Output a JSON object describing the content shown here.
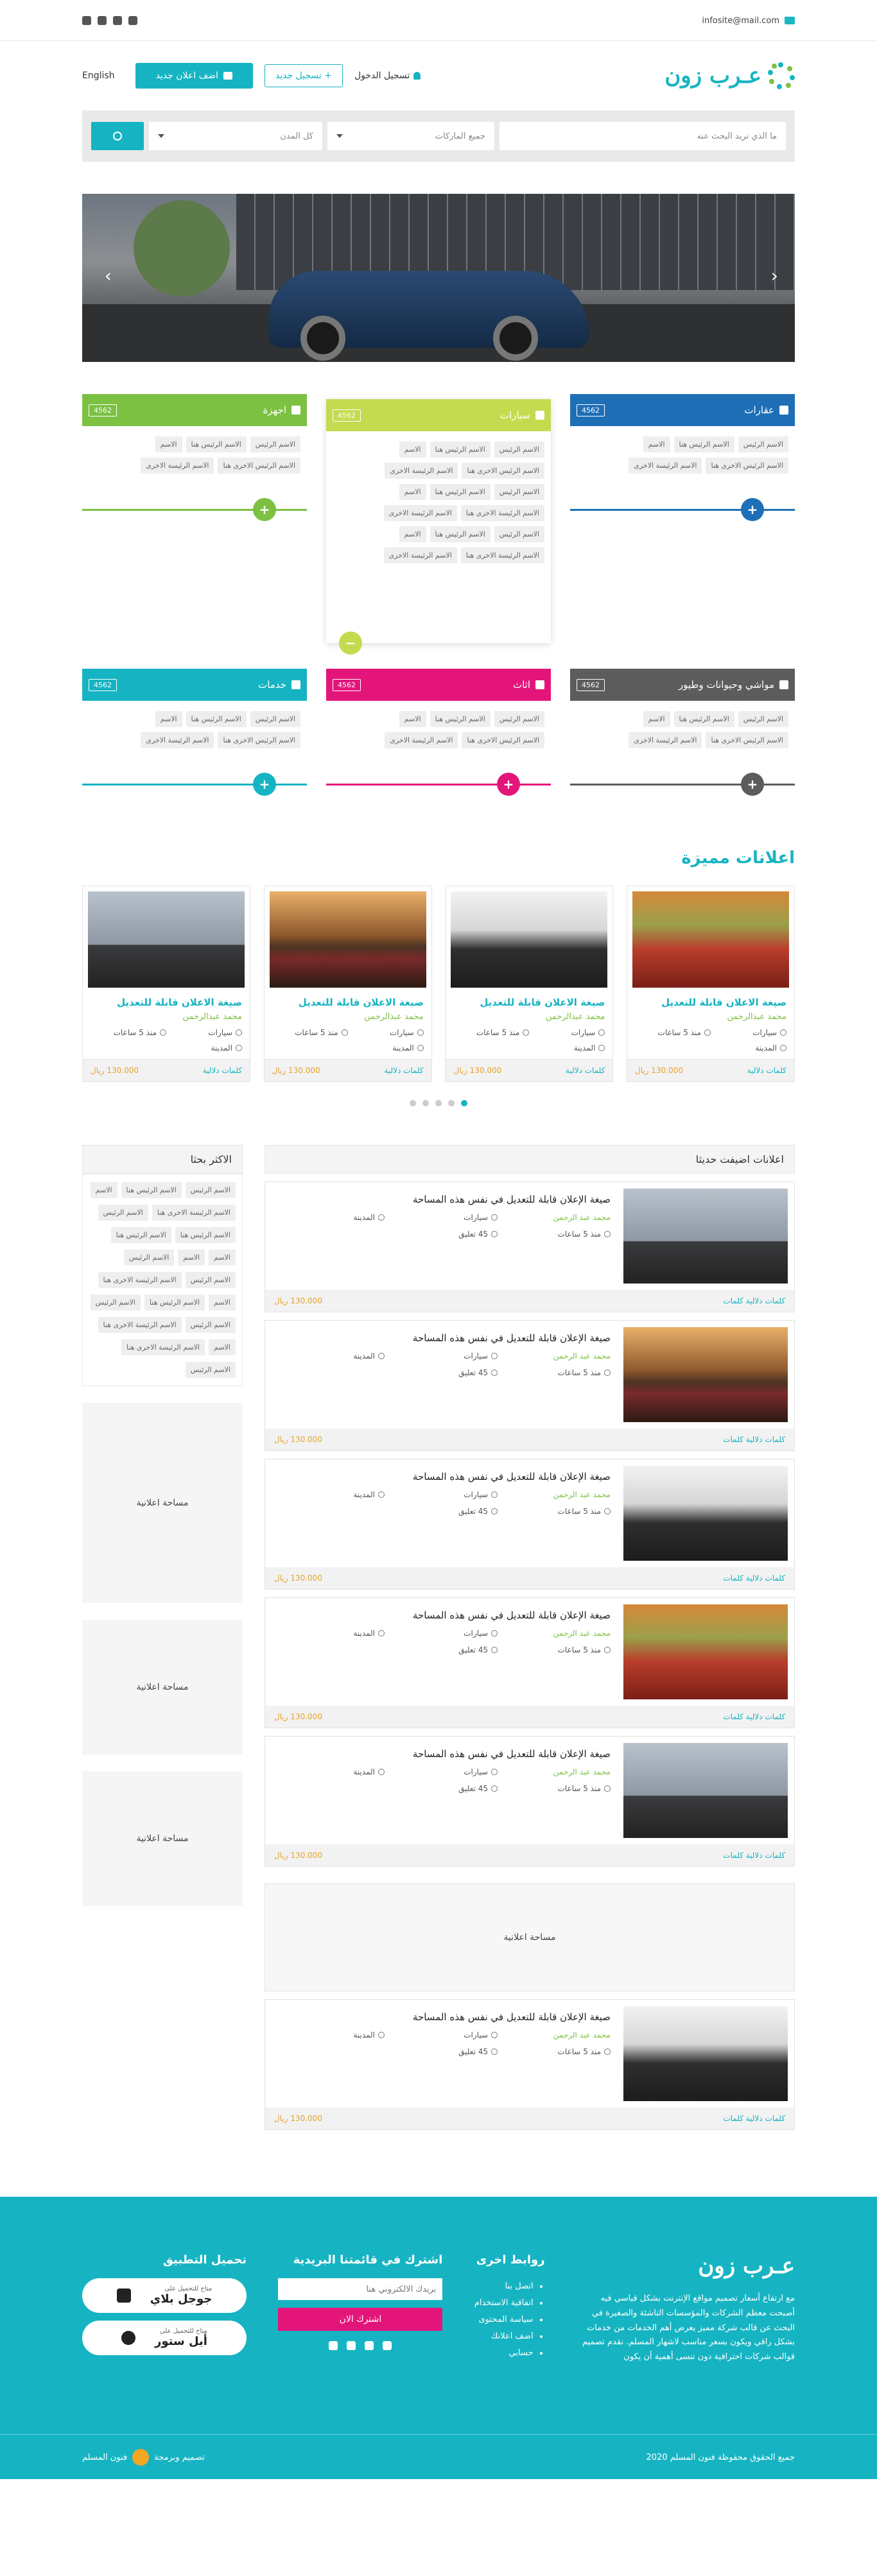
{
  "topbar": {
    "email": "infosite@mail.com",
    "social_icons": [
      "instagram-icon",
      "snapchat-icon",
      "twitter-icon",
      "email-icon"
    ]
  },
  "header": {
    "logo_text": "عـرب زون",
    "login": "تسجيل الدخول",
    "register": "تسجيل جديد",
    "add_ad": "اضف اعلان جديد",
    "language": "English"
  },
  "search": {
    "placeholder": "ما الذي تريد البحث عنه",
    "brands": "جميع الماركات",
    "cities": "كل المدن"
  },
  "categories": [
    {
      "title": "عقارات",
      "count": "4562",
      "color": "#1f6fb7",
      "tags": [
        "الاسم الرئيس",
        "الاسم الرئيس هنا",
        "الاسم",
        "الاسم الرئيس الاخرى هنا",
        "الاسم الرئيسة الاخرى"
      ]
    },
    {
      "title": "سيارات",
      "count": "4562",
      "color": "#c4db4f",
      "tags": [
        "الاسم الرئيس",
        "الاسم الرئيس هنا",
        "الاسم",
        "الاسم الرئيس الاخرى هنا",
        "الاسم الرئيسة الاخرى",
        "الاسم الرئيس",
        "الاسم الرئيس هنا",
        "الاسم",
        "الاسم الرئيسة الاخرى هنا",
        "الاسم الرئيسة الاخرى",
        "الاسم الرئيس",
        "الاسم الرئيس هنا",
        "الاسم",
        "الاسم الرئيسة الاخرى هنا",
        "الاسم الرئيسة الاخرى"
      ]
    },
    {
      "title": "اجهزة",
      "count": "4562",
      "color": "#7cc142",
      "tags": [
        "الاسم الرئيس",
        "الاسم الرئيس هنا",
        "الاسم",
        "الاسم الرئيس الاخرى هنا",
        "الاسم الرئيسة الاخرى"
      ]
    },
    {
      "title": "مواشي وحيوانات وطيور",
      "count": "4562",
      "color": "#5c5c5c",
      "tags": [
        "الاسم الرئيس",
        "الاسم الرئيس هنا",
        "الاسم",
        "الاسم الرئيس الاخرى هنا",
        "الاسم الرئيسة الاخرى"
      ]
    },
    {
      "title": "اثاث",
      "count": "4562",
      "color": "#e4157a",
      "tags": [
        "الاسم الرئيس",
        "الاسم الرئيس هنا",
        "الاسم",
        "الاسم الرئيس الاخرى هنا",
        "الاسم الرئيسة الاخرى"
      ]
    },
    {
      "title": "خدمات",
      "count": "4562",
      "color": "#16b4c2",
      "tags": [
        "الاسم الرئيس",
        "الاسم الرئيس هنا",
        "الاسم",
        "الاسم الرئيس الاخرى هنا",
        "الاسم الرئيسة الاخرى"
      ]
    }
  ],
  "featured": {
    "title": "اعلانات مميزة",
    "cards": [
      {
        "title": "صيغة الاعلان قابلة للتعديل",
        "author": "محمد عبدالرحمن",
        "category": "سيارات",
        "time": "منذ 5 ساعات",
        "city": "المدينة",
        "keywords": "كلمات دلالية",
        "price": "130.000 ريال",
        "photo": "orange"
      },
      {
        "title": "صيغة الاعلان قابلة للتعديل",
        "author": "محمد عبدالرحمن",
        "category": "سيارات",
        "time": "منذ 5 ساعات",
        "city": "المدينة",
        "keywords": "كلمات دلالية",
        "price": "130.000 ريال",
        "photo": "gray"
      },
      {
        "title": "صيغة الاعلان قابلة للتعديل",
        "author": "محمد عبدالرحمن",
        "category": "سيارات",
        "time": "منذ 5 ساعات",
        "city": "المدينة",
        "keywords": "كلمات دلالية",
        "price": "130.000 ريال",
        "photo": "sunset"
      },
      {
        "title": "صيغة الاعلان قابلة للتعديل",
        "author": "محمد عبدالرحمن",
        "category": "سيارات",
        "time": "منذ 5 ساعات",
        "city": "المدينة",
        "keywords": "كلمات دلالية",
        "price": "130.000 ريال",
        "photo": "dark"
      }
    ]
  },
  "recent": {
    "title": "اعلانات اضيفت حديثا",
    "ad_space": "مساحة اعلانية",
    "cards": [
      {
        "title": "صيغة الإعلان قابلة للتعديل في نفس هذه المساحة",
        "author": "محمد عبد الرحمن",
        "category": "سيارات",
        "city": "المدينة",
        "time": "منذ 5 ساعات",
        "comments": "45 تعليق",
        "keywords": "كلمات دلالية كلمات",
        "price": "130.000 ريال",
        "photo": "dark"
      },
      {
        "title": "صيغة الإعلان قابلة للتعديل في نفس هذه المساحة",
        "author": "محمد عبد الرحمن",
        "category": "سيارات",
        "city": "المدينة",
        "time": "منذ 5 ساعات",
        "comments": "45 تعليق",
        "keywords": "كلمات دلالية كلمات",
        "price": "130.000 ريال",
        "photo": "sunset"
      },
      {
        "title": "صيغة الإعلان قابلة للتعديل في نفس هذه المساحة",
        "author": "محمد عبد الرحمن",
        "category": "سيارات",
        "city": "المدينة",
        "time": "منذ 5 ساعات",
        "comments": "45 تعليق",
        "keywords": "كلمات دلالية كلمات",
        "price": "130.000 ريال",
        "photo": "gray"
      },
      {
        "title": "صيغة الإعلان قابلة للتعديل في نفس هذه المساحة",
        "author": "محمد عبد الرحمن",
        "category": "سيارات",
        "city": "المدينة",
        "time": "منذ 5 ساعات",
        "comments": "45 تعليق",
        "keywords": "كلمات دلالية كلمات",
        "price": "130.000 ريال",
        "photo": "orange"
      },
      {
        "title": "صيغة الإعلان قابلة للتعديل في نفس هذه المساحة",
        "author": "محمد عبد الرحمن",
        "category": "سيارات",
        "city": "المدينة",
        "time": "منذ 5 ساعات",
        "comments": "45 تعليق",
        "keywords": "كلمات دلالية كلمات",
        "price": "130.000 ريال",
        "photo": "dark"
      },
      {
        "title": "صيغة الإعلان قابلة للتعديل في نفس هذه المساحة",
        "author": "محمد عبد الرحمن",
        "category": "سيارات",
        "city": "المدينة",
        "time": "منذ 5 ساعات",
        "comments": "45 تعليق",
        "keywords": "كلمات دلالية كلمات",
        "price": "130.000 ريال",
        "photo": "gray"
      }
    ]
  },
  "sidebar": {
    "title": "الاكثر بحثا",
    "tags": [
      "الاسم الرئيس",
      "الاسم الرئيس هنا",
      "الاسم",
      "الاسم الرئيسة الاخرى هنا",
      "الاسم الرئيس",
      "الاسم الرئيس هنا",
      "الاسم الرئيس هنا",
      "الاسم",
      "الاسم",
      "الاسم الرئيس",
      "الاسم الرئيس",
      "الاسم الرئيسة الاخرى هنا",
      "الاسم",
      "الاسم الرئيس هنا",
      "الاسم الرئيس",
      "الاسم الرئيس",
      "الاسم الرئيسة الاخرى هنا",
      "الاسم",
      "الاسم الرئيسة الاخرى هنا",
      "الاسم الرئيس"
    ],
    "ad_space": "مساحة اعلانية"
  },
  "footer": {
    "logo_text": "عـرب زون",
    "about": "مع ارتفاع أسعار تصميم مواقع الإنترنت بشكل قياسي فيه أصبحت معظم الشركات والمؤسسات الناشئة والصغيرة في البحث عن قالب شركة مميز يعرض أهم الخدمات من خدمات بشكل راقي ويكون بسعر مناسب لاشهار المسلم. نقدم تصميم قوالب شركات احترافية دون تنسى أهمية أن يكون",
    "links_title": "روابط اخرى",
    "links": [
      "اتصل بنا",
      "اتفاقية الاستخدام",
      "سياسة المحتوى",
      "اضف اعلانك",
      "حسابي"
    ],
    "news_title": "اشترك في قائمتنا البريدية",
    "news_placeholder": "بريدك الالكتروني هنا",
    "news_button": "اشترك الان",
    "app_title": "تحميل التطبيق",
    "store1_small": "متاح للتحميل على",
    "store1_name": "جوجل بلاي",
    "store2_small": "متاح للتحميل على",
    "store2_name": "أبل ستور",
    "copyright": "جميع الحقوق محفوظة فنون المسلم 2020",
    "design_by": "تصميم وبرمجة",
    "design_company": "فنون المسلم"
  }
}
